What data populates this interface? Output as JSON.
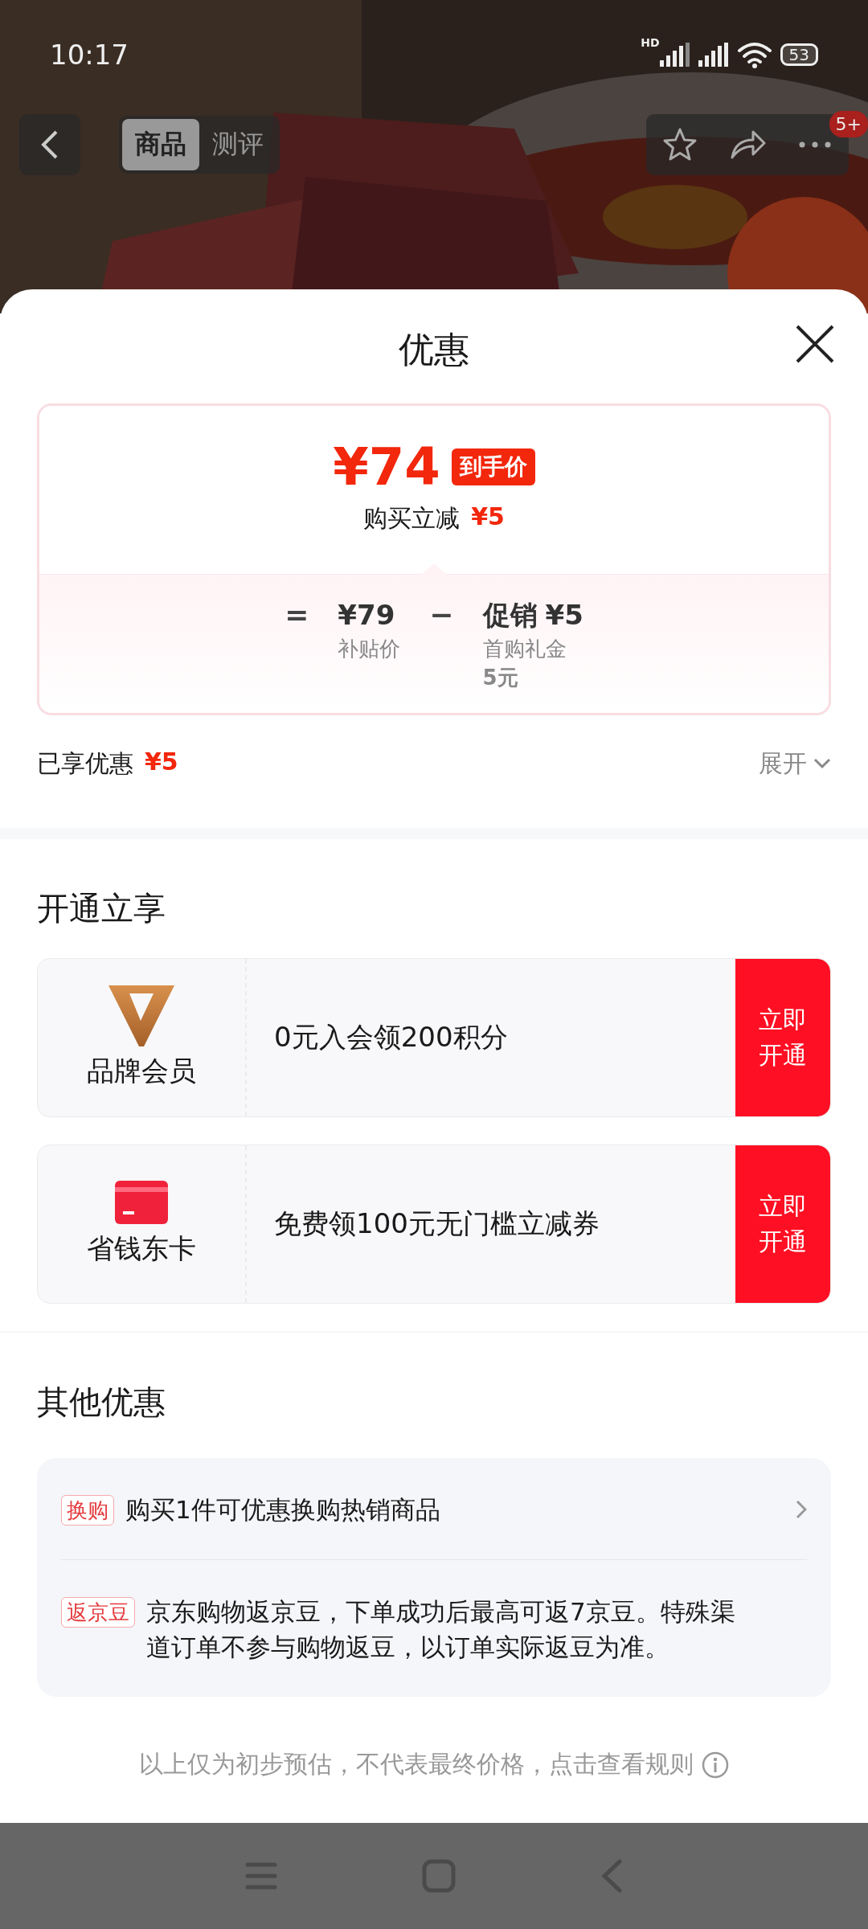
{
  "status_bar": {
    "time": "10:17",
    "network_label": "HD",
    "battery": "53"
  },
  "top_bar": {
    "tabs": [
      {
        "label": "商品",
        "selected": true
      },
      {
        "label": "测评",
        "selected": false
      }
    ],
    "badge": "5+"
  },
  "sheet": {
    "title": "优惠",
    "price_card": {
      "price": "¥74",
      "price_tag": "到手价",
      "reduction_label": "购买立减",
      "reduction_value": "¥5",
      "equals": "=",
      "base_price": "¥79",
      "base_label": "补贴价",
      "minus": "−",
      "promo_label": "促销",
      "promo_value": "¥5",
      "promo_notes": [
        "首购礼金",
        "5元"
      ]
    },
    "enjoyed": {
      "label": "已享优惠",
      "value": "¥5",
      "expand": "展开"
    },
    "membership": {
      "title": "开通立享",
      "cards": [
        {
          "kind": "brand",
          "name": "品牌会员",
          "benefit": "0元入会领200积分",
          "action": "立即开通"
        },
        {
          "kind": "card",
          "name": "省钱东卡",
          "benefit": "免费领100元无门槛立减券",
          "action": "立即开通"
        }
      ]
    },
    "other": {
      "title": "其他优惠",
      "items": [
        {
          "tag": "换购",
          "text": "购买1件可优惠换购热销商品",
          "arrow": true
        },
        {
          "tag": "返京豆",
          "text": "京东购物返京豆，下单成功后最高可返7京豆。特殊渠道订单不参与购物返豆，以订单实际返豆为准。",
          "arrow": false
        }
      ]
    },
    "footer_note": "以上仅为初步预估，不代表最终价格，点击查看规则"
  }
}
